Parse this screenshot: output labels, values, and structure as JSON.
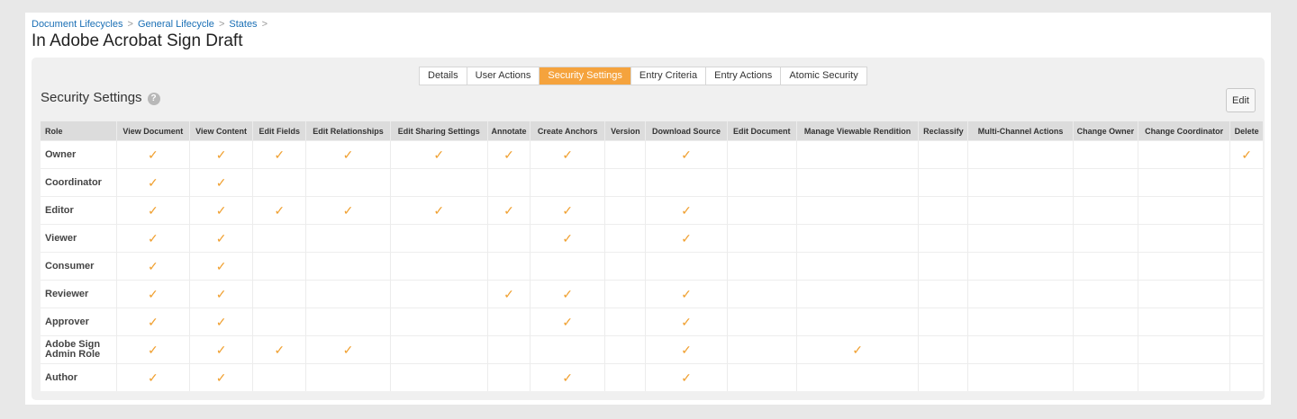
{
  "breadcrumb": [
    "Document Lifecycles",
    "General Lifecycle",
    "States"
  ],
  "breadcrumb_separator": ">",
  "title": "In Adobe Acrobat Sign Draft",
  "tabs": [
    {
      "label": "Details",
      "active": false
    },
    {
      "label": "User Actions",
      "active": false
    },
    {
      "label": "Security Settings",
      "active": true
    },
    {
      "label": "Entry Criteria",
      "active": false
    },
    {
      "label": "Entry Actions",
      "active": false
    },
    {
      "label": "Atomic Security",
      "active": false
    }
  ],
  "section": {
    "title": "Security Settings",
    "help_icon": "question-circle-icon",
    "edit_label": "Edit"
  },
  "table": {
    "columns": [
      "Role",
      "View Document",
      "View Content",
      "Edit Fields",
      "Edit Relationships",
      "Edit Sharing Settings",
      "Annotate",
      "Create Anchors",
      "Version",
      "Download Source",
      "Edit Document",
      "Manage Viewable Rendition",
      "Reclassify",
      "Multi-Channel Actions",
      "Change Owner",
      "Change Coordinator",
      "Delete"
    ],
    "rows": [
      {
        "role": "Owner",
        "checks": [
          1,
          1,
          1,
          1,
          1,
          1,
          1,
          0,
          1,
          0,
          0,
          0,
          0,
          0,
          0,
          1
        ]
      },
      {
        "role": "Coordinator",
        "checks": [
          1,
          1,
          0,
          0,
          0,
          0,
          0,
          0,
          0,
          0,
          0,
          0,
          0,
          0,
          0,
          0
        ]
      },
      {
        "role": "Editor",
        "checks": [
          1,
          1,
          1,
          1,
          1,
          1,
          1,
          0,
          1,
          0,
          0,
          0,
          0,
          0,
          0,
          0
        ]
      },
      {
        "role": "Viewer",
        "checks": [
          1,
          1,
          0,
          0,
          0,
          0,
          1,
          0,
          1,
          0,
          0,
          0,
          0,
          0,
          0,
          0
        ]
      },
      {
        "role": "Consumer",
        "checks": [
          1,
          1,
          0,
          0,
          0,
          0,
          0,
          0,
          0,
          0,
          0,
          0,
          0,
          0,
          0,
          0
        ]
      },
      {
        "role": "Reviewer",
        "checks": [
          1,
          1,
          0,
          0,
          0,
          1,
          1,
          0,
          1,
          0,
          0,
          0,
          0,
          0,
          0,
          0
        ]
      },
      {
        "role": "Approver",
        "checks": [
          1,
          1,
          0,
          0,
          0,
          0,
          1,
          0,
          1,
          0,
          0,
          0,
          0,
          0,
          0,
          0
        ]
      },
      {
        "role": "Adobe Sign Admin Role",
        "checks": [
          1,
          1,
          1,
          1,
          0,
          0,
          0,
          0,
          1,
          0,
          1,
          0,
          0,
          0,
          0,
          0
        ]
      },
      {
        "role": "Author",
        "checks": [
          1,
          1,
          0,
          0,
          0,
          0,
          1,
          0,
          1,
          0,
          0,
          0,
          0,
          0,
          0,
          0
        ]
      }
    ],
    "check_glyph": "✓",
    "check_color": "#f0a030"
  },
  "accent_color": "#f5a33d"
}
